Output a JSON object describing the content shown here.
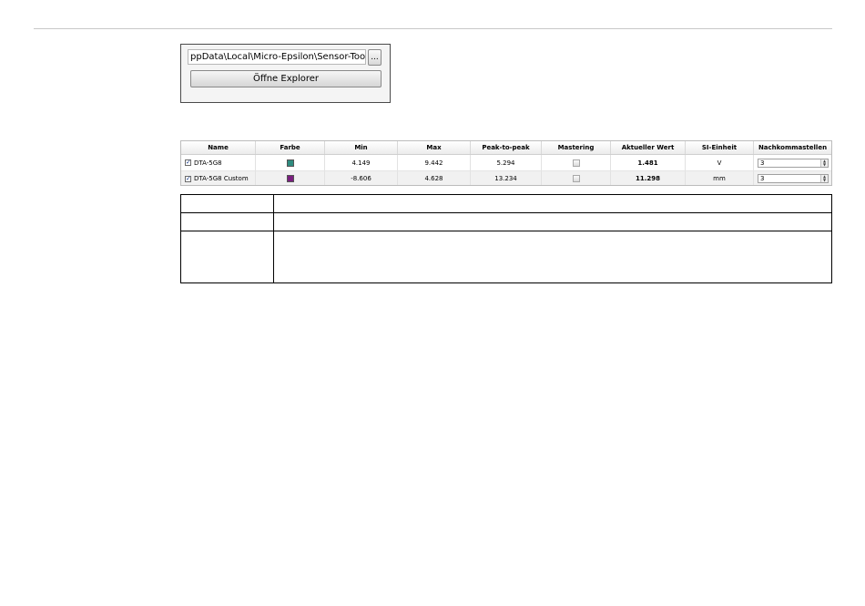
{
  "path_widget": {
    "path_value": "ppData\\Local\\Micro-Epsilon\\Sensor-Tools",
    "browse_label": "...",
    "explorer_label": "Öffne Explorer"
  },
  "channel_table": {
    "headers": [
      "Name",
      "Farbe",
      "Min",
      "Max",
      "Peak-to-peak",
      "Mastering",
      "Aktueller Wert",
      "SI-Einheit",
      "Nachkommastellen"
    ],
    "rows": [
      {
        "name": "DTA-5G8",
        "checked": true,
        "color": "#2e8b7f",
        "min": "4.149",
        "max": "9.442",
        "p2p": "5.294",
        "mastering": false,
        "aktuell": "1.481",
        "si": "V",
        "nachkomma": "3"
      },
      {
        "name": "DTA-5G8 Custom",
        "checked": true,
        "color": "#7a1f7f",
        "min": "-8.606",
        "max": "4.628",
        "p2p": "13.234",
        "mastering": false,
        "aktuell": "11.298",
        "si": "mm",
        "nachkomma": "3"
      }
    ]
  }
}
